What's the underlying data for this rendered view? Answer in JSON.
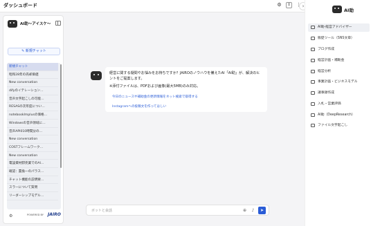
{
  "header": {
    "title": "ダッシュボード"
  },
  "left_panel": {
    "title": "AI助〜アイスケ〜",
    "new_chat_label": "新規チャット",
    "history": [
      "新規チャット",
      "昭和28年の売却価値",
      "New conversation",
      "difyのイテレーション…",
      "音声文字起こしの可能…",
      "RESASの次年度につい…",
      "notebookImplusの価格…",
      "Windowsの音声領域に…",
      "音声API010時間分の…",
      "New conversation",
      "COSTフレームワーク…",
      "New conversation",
      "電設資材卸売業でのAI…",
      "確認：置換一のパラス…",
      "チャット機能の説明要…",
      "スラーについて質問",
      "リーダーシップモデル…"
    ],
    "powered_by": "POWERED BY",
    "brand": "JAIRO"
  },
  "chat": {
    "message": "経営に関する疑問やお悩みをお持ちですか？JAIROのノウハウを備えたAI「AI助」が、解決のヒントをご提案します。",
    "note": "※添付ファイルは、PDFおよび画像(最大5MB)のみ対応。",
    "suggestions": [
      "今日のニュースや補助金の更新情報をネット検索で取得する",
      "Instagramへの投稿文を作ってほしい"
    ],
    "input_placeholder": "ボットと会話"
  },
  "right_panel": {
    "title": "AI助",
    "items": [
      "AI助-経営アドバイザー",
      "販促ツール（SNS文章）",
      "ブログ作成",
      "経営計画・補助金",
      "経営分析",
      "事業計画・ビジネスモデル",
      "議事録作成",
      "入札・営業評価",
      "AI助（DeepResearch）",
      "ファイル文字起こし"
    ]
  },
  "colors": {
    "accent": "#2a5cd6",
    "sidebar_bg": "#eef0f4",
    "main_bg": "#f4f4f6"
  }
}
